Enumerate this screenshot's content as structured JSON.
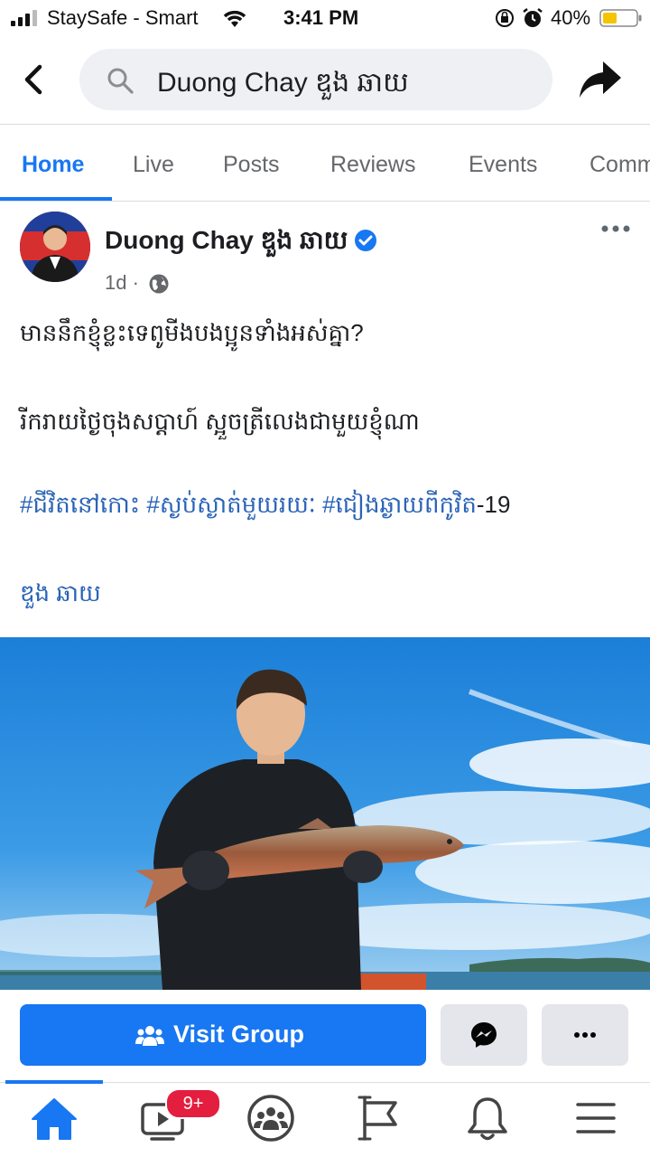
{
  "status_bar": {
    "carrier": "StaySafe - Smart",
    "time": "3:41 PM",
    "battery_percent": "40%",
    "icons": [
      "signal-icon",
      "wifi-icon",
      "rotation-lock-icon",
      "alarm-icon",
      "battery-icon"
    ]
  },
  "header": {
    "search_value": "Duong Chay ឌួង ឆាយ",
    "back_icon": "chevron-left-icon",
    "share_icon": "share-arrow-icon"
  },
  "tabs": [
    {
      "label": "Home",
      "active": true
    },
    {
      "label": "Live",
      "active": false
    },
    {
      "label": "Posts",
      "active": false
    },
    {
      "label": "Reviews",
      "active": false
    },
    {
      "label": "Events",
      "active": false
    },
    {
      "label": "Comm",
      "active": false
    }
  ],
  "post": {
    "author": "Duong Chay ឌួង ឆាយ",
    "time": "1d ·",
    "verified": true,
    "lines": [
      "មាននឹកខ្ញុំខ្លះទេពូមីងបងប្អូនទាំងអស់គ្នា?",
      "រីករាយថ្ងៃចុងសប្តាហ៍ ស្អួចត្រីលេងជាមួយខ្ញុំណា"
    ],
    "hashtags": [
      "#ជីវិតនៅកោះ",
      "#ស្ងប់ស្ងាត់មួយរយៈ",
      "#ជៀងឆ្ងាយពីកូវិត"
    ],
    "hashtag_suffix": "-19",
    "mention": "ឌួង ឆាយ"
  },
  "actions": {
    "visit_group": "Visit Group",
    "messenger_icon": "messenger-icon",
    "more_icon": "more-icon"
  },
  "bottom_nav": {
    "items": [
      "home-icon",
      "watch-icon",
      "groups-icon",
      "pages-flag-icon",
      "notifications-bell-icon",
      "menu-icon"
    ],
    "watch_badge": "9+"
  },
  "colors": {
    "accent": "#1877f2",
    "badge": "#e41e3f",
    "link": "#2a64b7"
  }
}
